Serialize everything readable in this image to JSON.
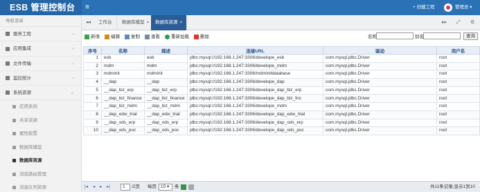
{
  "header": {
    "logo": "ESB 管理控制台",
    "menu_icon": "≡",
    "create_label": "+ 创建工程",
    "user_label": "管理员 ▾"
  },
  "sidebar": {
    "title": "导航菜单",
    "groups": [
      {
        "label": "服务工程",
        "arrow": "‹"
      },
      {
        "label": "应用集成",
        "arrow": "‹"
      },
      {
        "label": "文件传输",
        "arrow": "‹"
      },
      {
        "label": "监控统计",
        "arrow": "‹"
      },
      {
        "label": "系统资源",
        "arrow": "⌄"
      }
    ],
    "subitems": [
      "应用系统",
      "共享资源",
      "属性配置",
      "数据库模型",
      "数据库资源",
      "消息路由管理",
      "消息队列资源"
    ],
    "active_index": 4
  },
  "tabs": {
    "prev": "◂◂",
    "next": "▸▸",
    "expand": "⤢",
    "settings": "⚙",
    "items": [
      {
        "label": "工作台",
        "closable": false
      },
      {
        "label": "数据库模型",
        "closable": true
      },
      {
        "label": "数据库资源",
        "closable": true
      }
    ],
    "active": 2,
    "close": "×"
  },
  "toolbar": {
    "add": "新增",
    "edit": "编辑",
    "copy": "复制",
    "view": "查看",
    "reload": "重新加载",
    "delete": "删除",
    "name_label": "名称",
    "alias_label": "别名",
    "query": "查询"
  },
  "table": {
    "headers": [
      "序号",
      "名称",
      "描述",
      "连接URL",
      "驱动",
      "用户名"
    ],
    "rows": [
      [
        "1",
        "esb",
        "esb",
        "jdbc:mysql://192.168.1.247:3306/develope_esb",
        "com.mysql.jdbc.Driver",
        "root"
      ],
      [
        "2",
        "mdm",
        "mdm",
        "jdbc:mysql://192.168.1.247:3306/develope_mdm",
        "com.mysql.jdbc.Driver",
        "root"
      ],
      [
        "3",
        "mdminit",
        "mdminit",
        "jdbc:mysql://192.168.1.247:3306/mdminitdatabase",
        "com.mysql.jdbc.Driver",
        "root"
      ],
      [
        "4",
        "__dap",
        "__dap",
        "jdbc:mysql://192.168.1.247:3306/develope_dap",
        "com.mysql.jdbc.Driver",
        "root"
      ],
      [
        "5",
        "__dap_biz_erp",
        "__dap_biz_erp",
        "jdbc:mysql://192.168.1.247:3306/develope_dap_biz_erp",
        "com.mysql.jdbc.Driver",
        "root"
      ],
      [
        "6",
        "__dap_biz_finance",
        "__dap_biz_finance",
        "jdbc:mysql://192.168.1.247:3306/develope_dap_biz_fnc",
        "com.mysql.jdbc.Driver",
        "root"
      ],
      [
        "7",
        "__dap_biz_mdm",
        "__dap_biz_mdm",
        "jdbc:mysql://192.168.1.247:3306/develope_mdm",
        "com.mysql.jdbc.Driver",
        "root"
      ],
      [
        "8",
        "__dap_edw_trial",
        "__dap_edw_trial",
        "jdbc:mysql://192.168.1.247:3306/develope_dap_edw_trial",
        "com.mysql.jdbc.Driver",
        "root"
      ],
      [
        "9",
        "__dap_ods_erp",
        "__dap_ods_erp",
        "jdbc:mysql://192.168.1.247:3306/develope_dap_ods_erp",
        "com.mysql.jdbc.Driver",
        "root"
      ],
      [
        "10",
        "__dap_ods_poc",
        "__dap_ods_poc",
        "jdbc:mysql://192.168.1.247:3306/develope_dap_ods_poc",
        "com.mysql.jdbc.Driver",
        "root"
      ]
    ]
  },
  "pager": {
    "first": "|◂",
    "prev": "◂",
    "next": "▸",
    "last": "▸|",
    "page": "1",
    "total_pages": "/2页",
    "per_page_label": "每页",
    "per_page": "10 ▾",
    "unit": "条",
    "summary": "共11条记录,显示1到10"
  },
  "colors": {
    "primary": "#2a72b5",
    "active_tab": "#2a5d96",
    "add_icon": "#3aa04a",
    "edit_icon": "#d48a1a",
    "delete_icon": "#d9362a",
    "reload_icon": "#28a048"
  }
}
